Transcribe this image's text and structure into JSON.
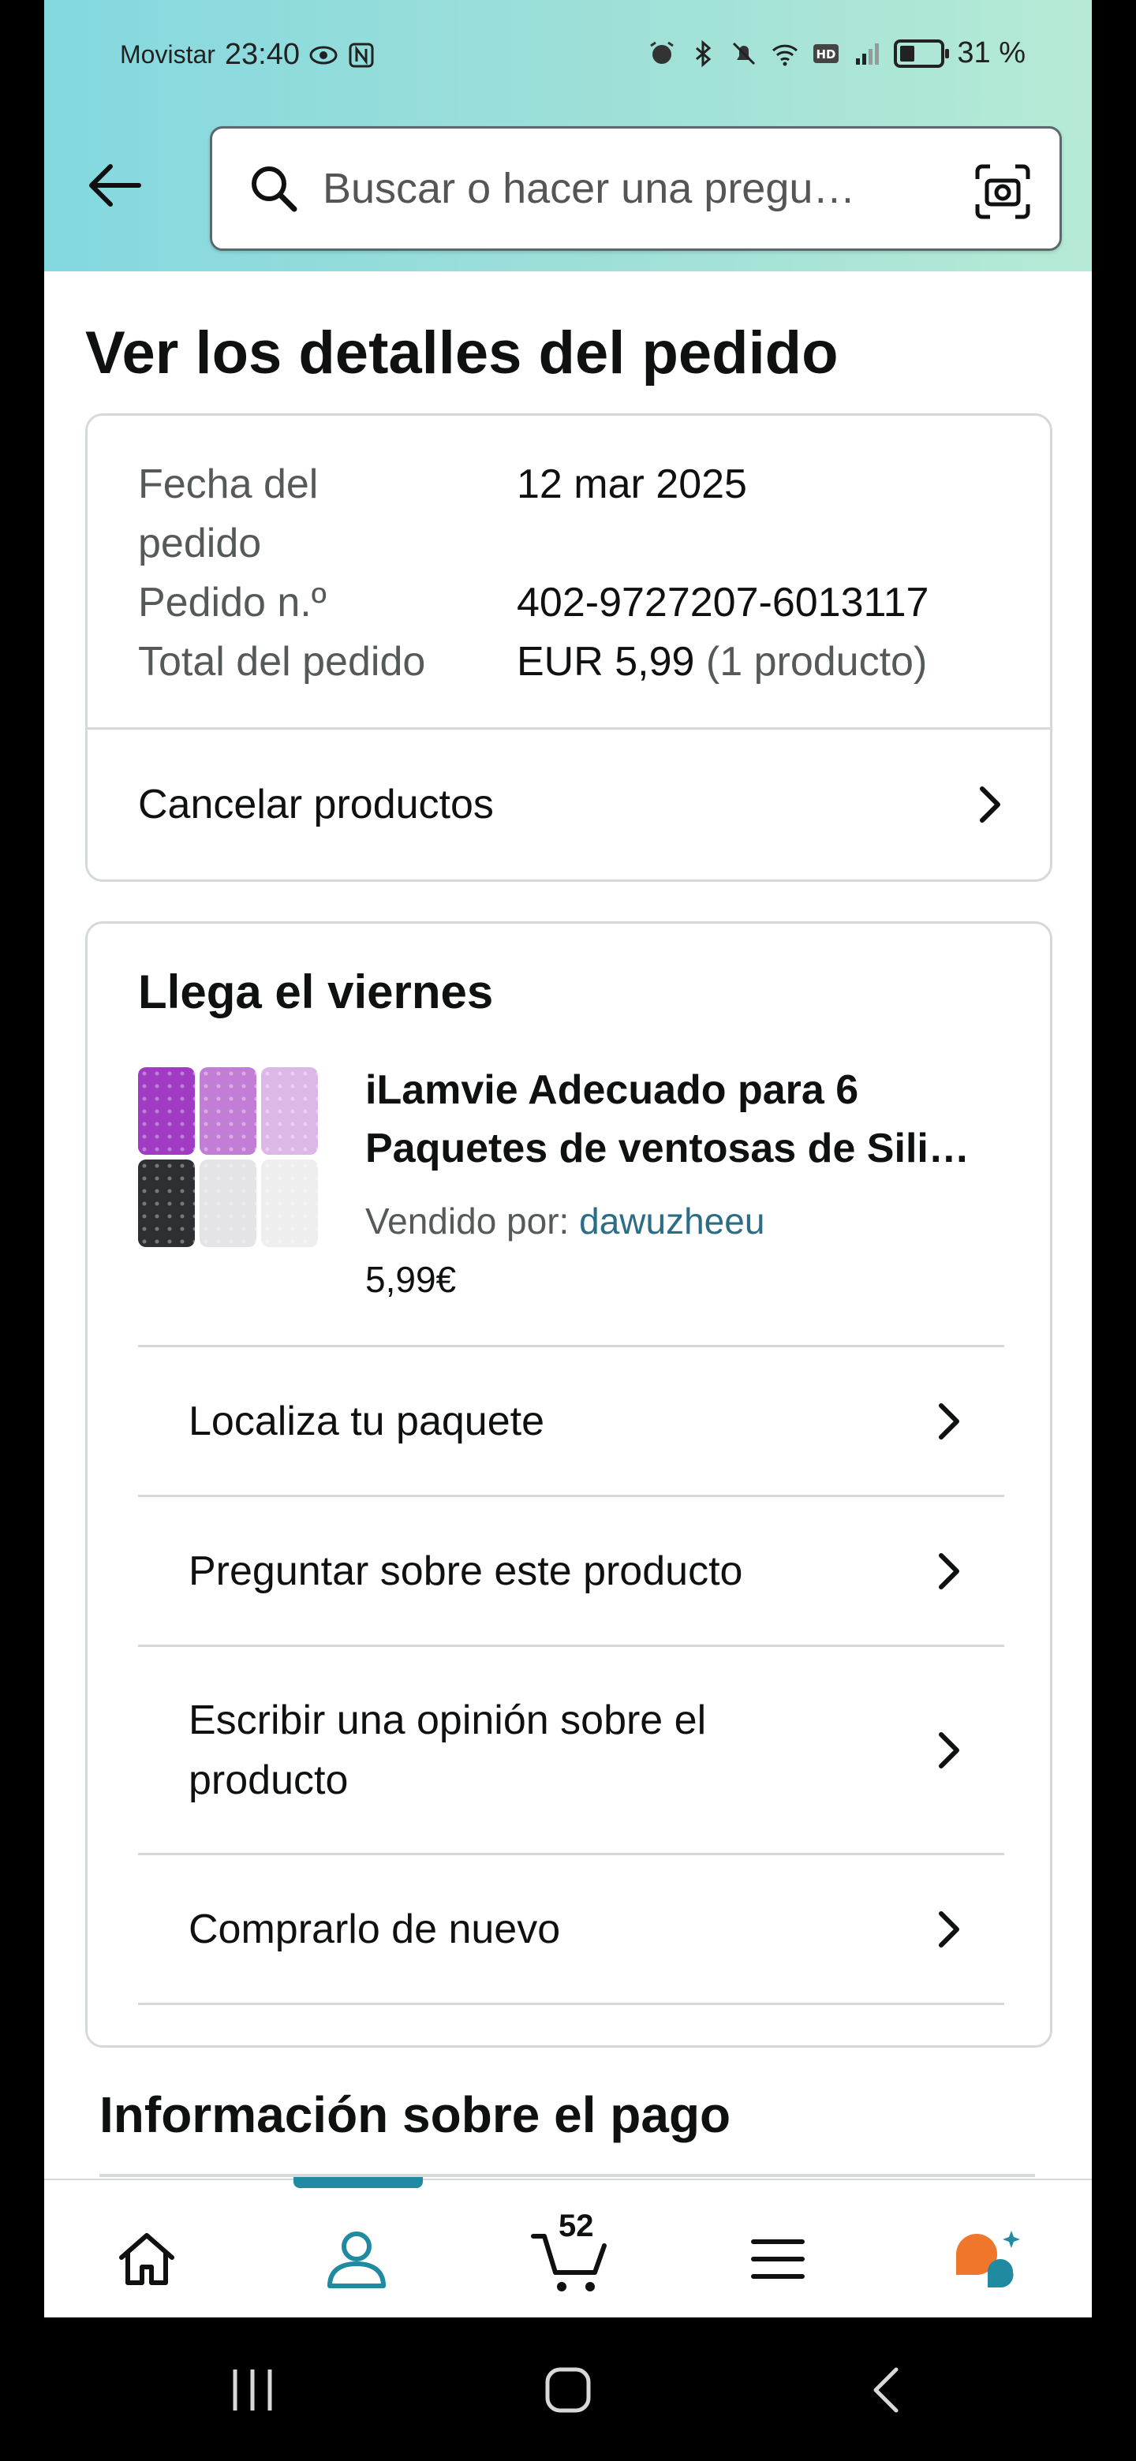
{
  "status_bar": {
    "carrier": "Movistar",
    "time": "23:40",
    "battery": "31 %"
  },
  "search": {
    "placeholder": "Buscar o hacer una pregu…"
  },
  "page": {
    "title": "Ver los detalles del pedido"
  },
  "order_details": {
    "date_label": "Fecha del pedido",
    "date_value": "12 mar 2025",
    "number_label": "Pedido n.º",
    "number_value": "402-9727207-6013117",
    "total_label": "Total del pedido",
    "total_value": "EUR 5,99",
    "total_count": "(1 producto)",
    "cancel_label": "Cancelar productos"
  },
  "shipment": {
    "arrival": "Llega el viernes",
    "product_title": "iLamvie Adecuado para 6 Paquetes de ventosas de Sili…",
    "sold_by_label": "Vendido por:",
    "seller": "dawuzheeu",
    "price": "5,99€",
    "actions": [
      "Localiza tu paquete",
      "Preguntar sobre este producto",
      "Escribir una opinión sobre el producto",
      "Comprarlo de nuevo"
    ],
    "swatch_colors": [
      "#a23bc4",
      "#c27ed6",
      "#dcb8e6",
      "#2e2f33",
      "#e4e4e6",
      "#eeeeee"
    ]
  },
  "payment": {
    "title": "Información sobre el pago"
  },
  "bottom_nav": {
    "cart_count": "52",
    "active_color": "#1f8aa0"
  }
}
